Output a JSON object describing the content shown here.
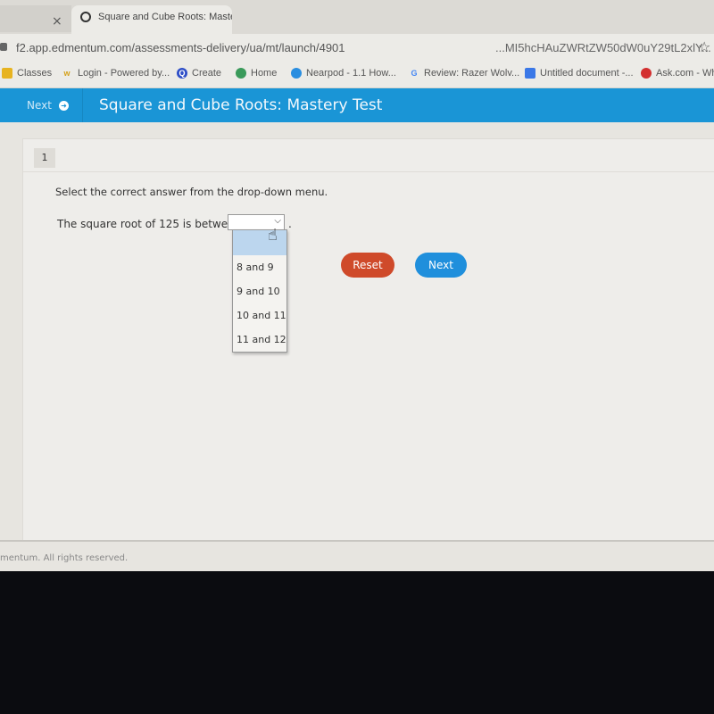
{
  "browser": {
    "tabs": [
      {
        "label": "Square and Cube Roots: Maste",
        "close_icon": "×"
      }
    ],
    "prev_tab_close": "×",
    "url": "f2.app.edmentum.com/assessments-delivery/ua/mt/launch/4901",
    "url_tail": "...MI5hcHAuZWRtZW50dW0uY29tL2xlY...",
    "bookmarks": [
      {
        "label": "Classes",
        "icon": "classroom-icon"
      },
      {
        "label": "Login - Powered by...",
        "icon": "w-icon"
      },
      {
        "label": "Create",
        "icon": "q-icon"
      },
      {
        "label": "Home",
        "icon": "shield-icon"
      },
      {
        "label": "Nearpod - 1.1 How...",
        "icon": "nearpod-icon"
      },
      {
        "label": "Review: Razer Wolv...",
        "icon": "google-icon"
      },
      {
        "label": "Untitled document -...",
        "icon": "docs-icon"
      },
      {
        "label": "Ask.com - Wh",
        "icon": "ask-icon"
      }
    ]
  },
  "header": {
    "nav_next_label": "Next",
    "title": "Square and Cube Roots: Mastery Test",
    "accent_color": "#1a95d6"
  },
  "question": {
    "number": "1",
    "instruction": "Select the correct answer from the drop-down menu.",
    "prompt": "The square root of 125 is between",
    "trailing": ".",
    "selected_value": "",
    "options": [
      "",
      "8 and 9",
      "9 and 10",
      "10 and 11",
      "11 and 12"
    ]
  },
  "buttons": {
    "reset_label": "Reset",
    "next_label": "Next",
    "reset_color": "#cf4a2a",
    "next_color": "#1f8fdc"
  },
  "footer": {
    "copyright": "mentum. All rights reserved."
  }
}
